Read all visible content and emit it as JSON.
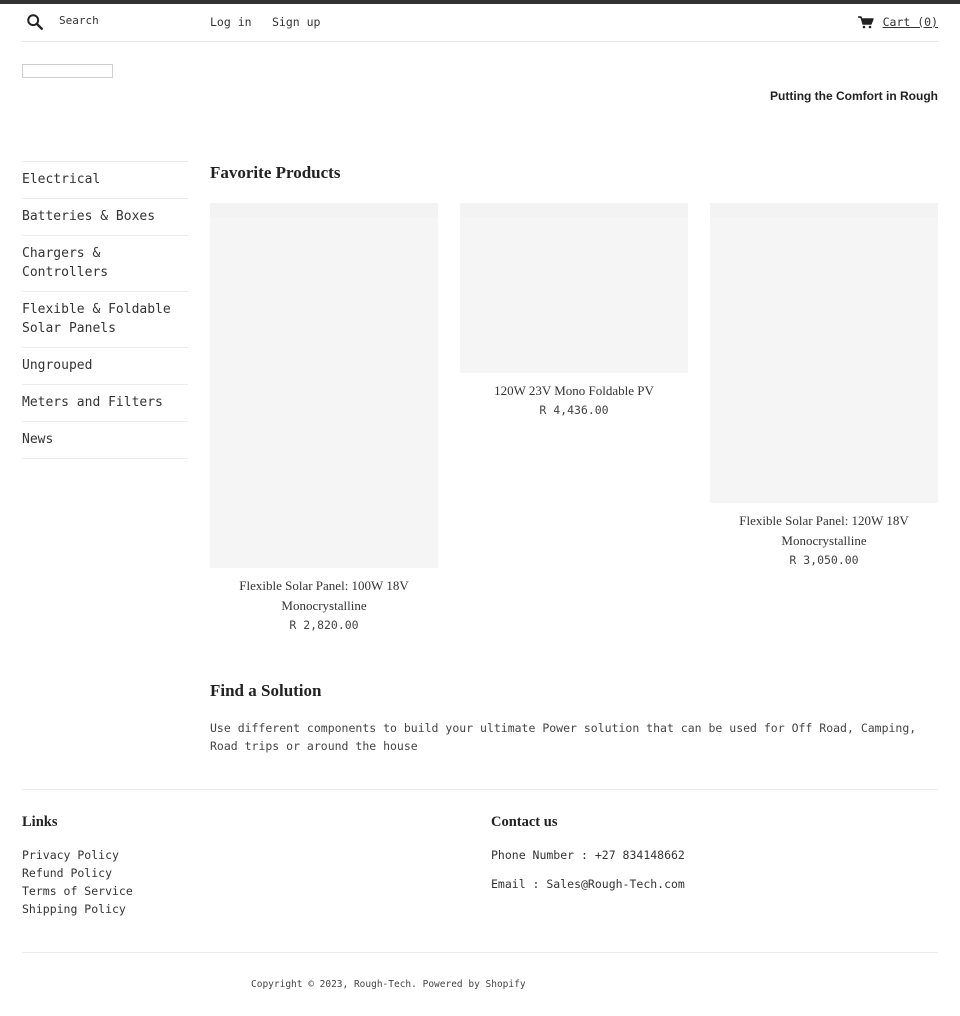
{
  "header": {
    "search_placeholder": "Search",
    "search_icon": "search-icon",
    "login_label": "Log in",
    "signup_label": "Sign up",
    "cart_icon": "cart-icon",
    "cart_label": "Cart (0)"
  },
  "brand": {
    "tagline": "Putting the Comfort in Rough"
  },
  "sidebar": {
    "items": [
      {
        "label": "Electrical"
      },
      {
        "label": "Batteries & Boxes"
      },
      {
        "label": "Chargers & Controllers"
      },
      {
        "label": "Flexible & Foldable Solar Panels"
      },
      {
        "label": "Ungrouped"
      },
      {
        "label": "Meters and Filters"
      },
      {
        "label": "News"
      }
    ]
  },
  "featured": {
    "title": "Favorite Products",
    "products": [
      {
        "name": "Flexible Solar Panel: 100W 18V Monocrystalline",
        "price": "R 2,820.00"
      },
      {
        "name": "120W 23V Mono Foldable PV",
        "price": "R 4,436.00"
      },
      {
        "name": "Flexible Solar Panel: 120W 18V Monocrystalline",
        "price": "R 3,050.00"
      }
    ]
  },
  "solution": {
    "title": "Find a Solution",
    "text": "Use different components to build your ultimate Power solution that can be used for Off Road, Camping, Road trips or around the house"
  },
  "footer": {
    "links_title": "Links",
    "links": [
      {
        "label": "Privacy Policy"
      },
      {
        "label": "Refund Policy"
      },
      {
        "label": "Terms of Service"
      },
      {
        "label": "Shipping Policy"
      }
    ],
    "contact_title": "Contact us",
    "phone": "Phone Number : +27 834148662",
    "email": "Email : Sales@Rough-Tech.com",
    "copyright_prefix": "Copyright © 2023, ",
    "copyright_brand": "Rough-Tech",
    "copyright_sep": ". ",
    "powered_by": "Powered by Shopify"
  }
}
